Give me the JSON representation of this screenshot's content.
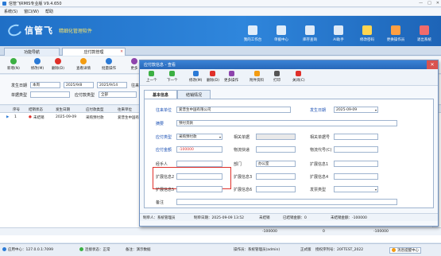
{
  "window": {
    "title": "信管飞RMIS专业版 V9.4.650"
  },
  "menu": [
    "系统(S)",
    "窗口(W)",
    "帮助"
  ],
  "brand": {
    "name": "信管飞",
    "slogan": "精细化管理软件"
  },
  "topnav": [
    "我的工作台",
    "单据中心",
    "库存查询",
    "AI助手",
    "修改密码",
    "更换操作员",
    "退出系统"
  ],
  "tabs": {
    "t1": "功能导航",
    "t2": "应付款管理"
  },
  "toolbar": [
    "新增(N)",
    "修改(M)",
    "删除(D)",
    "查看详情",
    "批量操作",
    "更多"
  ],
  "filters": {
    "date_label": "发生日期",
    "date_mode": "本周",
    "date_from": "2025/9/8",
    "date_to": "2025/9/14",
    "dir_label": "往来单",
    "dir_value": "",
    "type_label": "单据类型",
    "paytype_label": "应付款类型",
    "paytype_value": "全部"
  },
  "grid": {
    "headers": [
      "序号",
      "结销状态",
      "发生日期",
      "应付款类型",
      "往来单位",
      "应付款",
      "已结金额",
      "备注"
    ],
    "rows": [
      {
        "no": "1",
        "status": "未结销",
        "date": "2025-09-09",
        "type": "采购预付款",
        "party": "爱普生中国有限公司",
        "amount": "-100000",
        "settled": "0",
        "extra": "预付"
      }
    ],
    "totals": {
      "amount": "-100000",
      "settled": "0"
    }
  },
  "dialog": {
    "title": "应付款信息 - 查看",
    "toolbar": [
      "上一个",
      "下一个",
      "修改(M)",
      "删除(D)",
      "更多操作",
      "附件资料",
      "打印",
      "关闭(C)"
    ],
    "tabs": [
      "基本信息",
      "结销情况"
    ],
    "fields": {
      "party_label": "往来单位",
      "party": "爱普生中国有限公司",
      "date_label": "发生日期",
      "date": "2025-09-09",
      "summary_label": "摘要",
      "summary": "预付货款",
      "type_label": "应付类型",
      "type": "采购预付款",
      "amount_label": "应付金额",
      "amount": "-100000",
      "related_doc_label": "相关单据",
      "related_no_label": "相关单据号",
      "logistics_label": "物流快递",
      "logistics_no_label": "物流代号(C)",
      "handler_label": "经手人",
      "dept_label": "部门",
      "dept": "办公室",
      "ext1_label": "扩展信息1",
      "ext2_label": "扩展信息2",
      "ext3_label": "扩展信息3",
      "ext4_label": "扩展信息4",
      "ext5_label": "扩展信息5",
      "ext6_label": "扩展信息6",
      "ext7_label": "扩展信息7",
      "ext8_label": "扩展信息8",
      "invoice_label": "发票类型",
      "note_label": "备注"
    },
    "footer": {
      "maker": "制单人：系统管理员",
      "make_time": "制单日期：2025-09-09 13:52",
      "status": "未结销",
      "settled": "已结销金额：0",
      "unsettled": "未结销金额：-100000"
    }
  },
  "status": {
    "center": "应用中心：127.0.0.1:7099",
    "conn": "连接状态：正常",
    "remark": "备注：演示数据",
    "operator": "操作员：系统管理员(admin)",
    "edition": "正式版",
    "license": "授权序列号：20FTEST_2022",
    "msg": "消息提醒中心"
  },
  "colors": {
    "accent": "#2b7ad6",
    "danger": "#e0302a",
    "banner": "#2f86dc"
  }
}
